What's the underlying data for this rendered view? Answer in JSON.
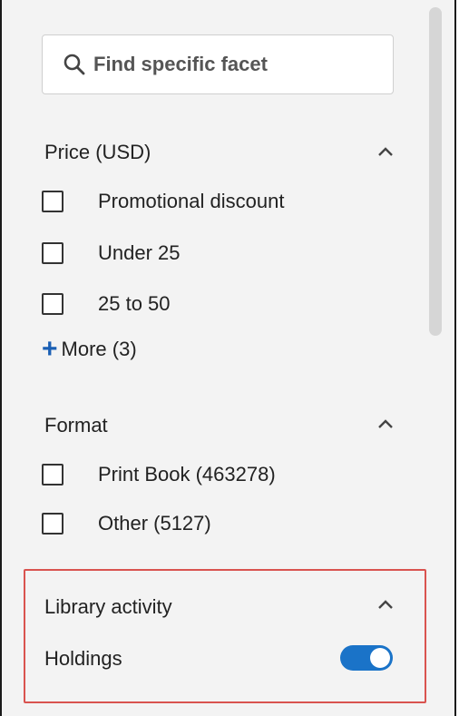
{
  "search": {
    "placeholder": "Find specific facet"
  },
  "facets": {
    "price": {
      "title": "Price (USD)",
      "options": [
        {
          "label": "Promotional discount",
          "checked": false
        },
        {
          "label": "Under 25",
          "checked": false
        },
        {
          "label": "25 to 50",
          "checked": false
        }
      ],
      "more_label": "More (3)"
    },
    "format": {
      "title": "Format",
      "options": [
        {
          "label": "Print Book (463278)",
          "checked": false
        },
        {
          "label": "Other (5127)",
          "checked": false
        }
      ]
    },
    "library_activity": {
      "title": "Library activity",
      "holdings_label": "Holdings",
      "holdings_enabled": true
    }
  },
  "colors": {
    "accent": "#1a73c8",
    "highlight_border": "#d9534f",
    "panel_background": "#f3f3f3"
  },
  "icons": {
    "search": "search-icon",
    "chevron": "chevron-up-icon",
    "plus": "plus-icon"
  }
}
